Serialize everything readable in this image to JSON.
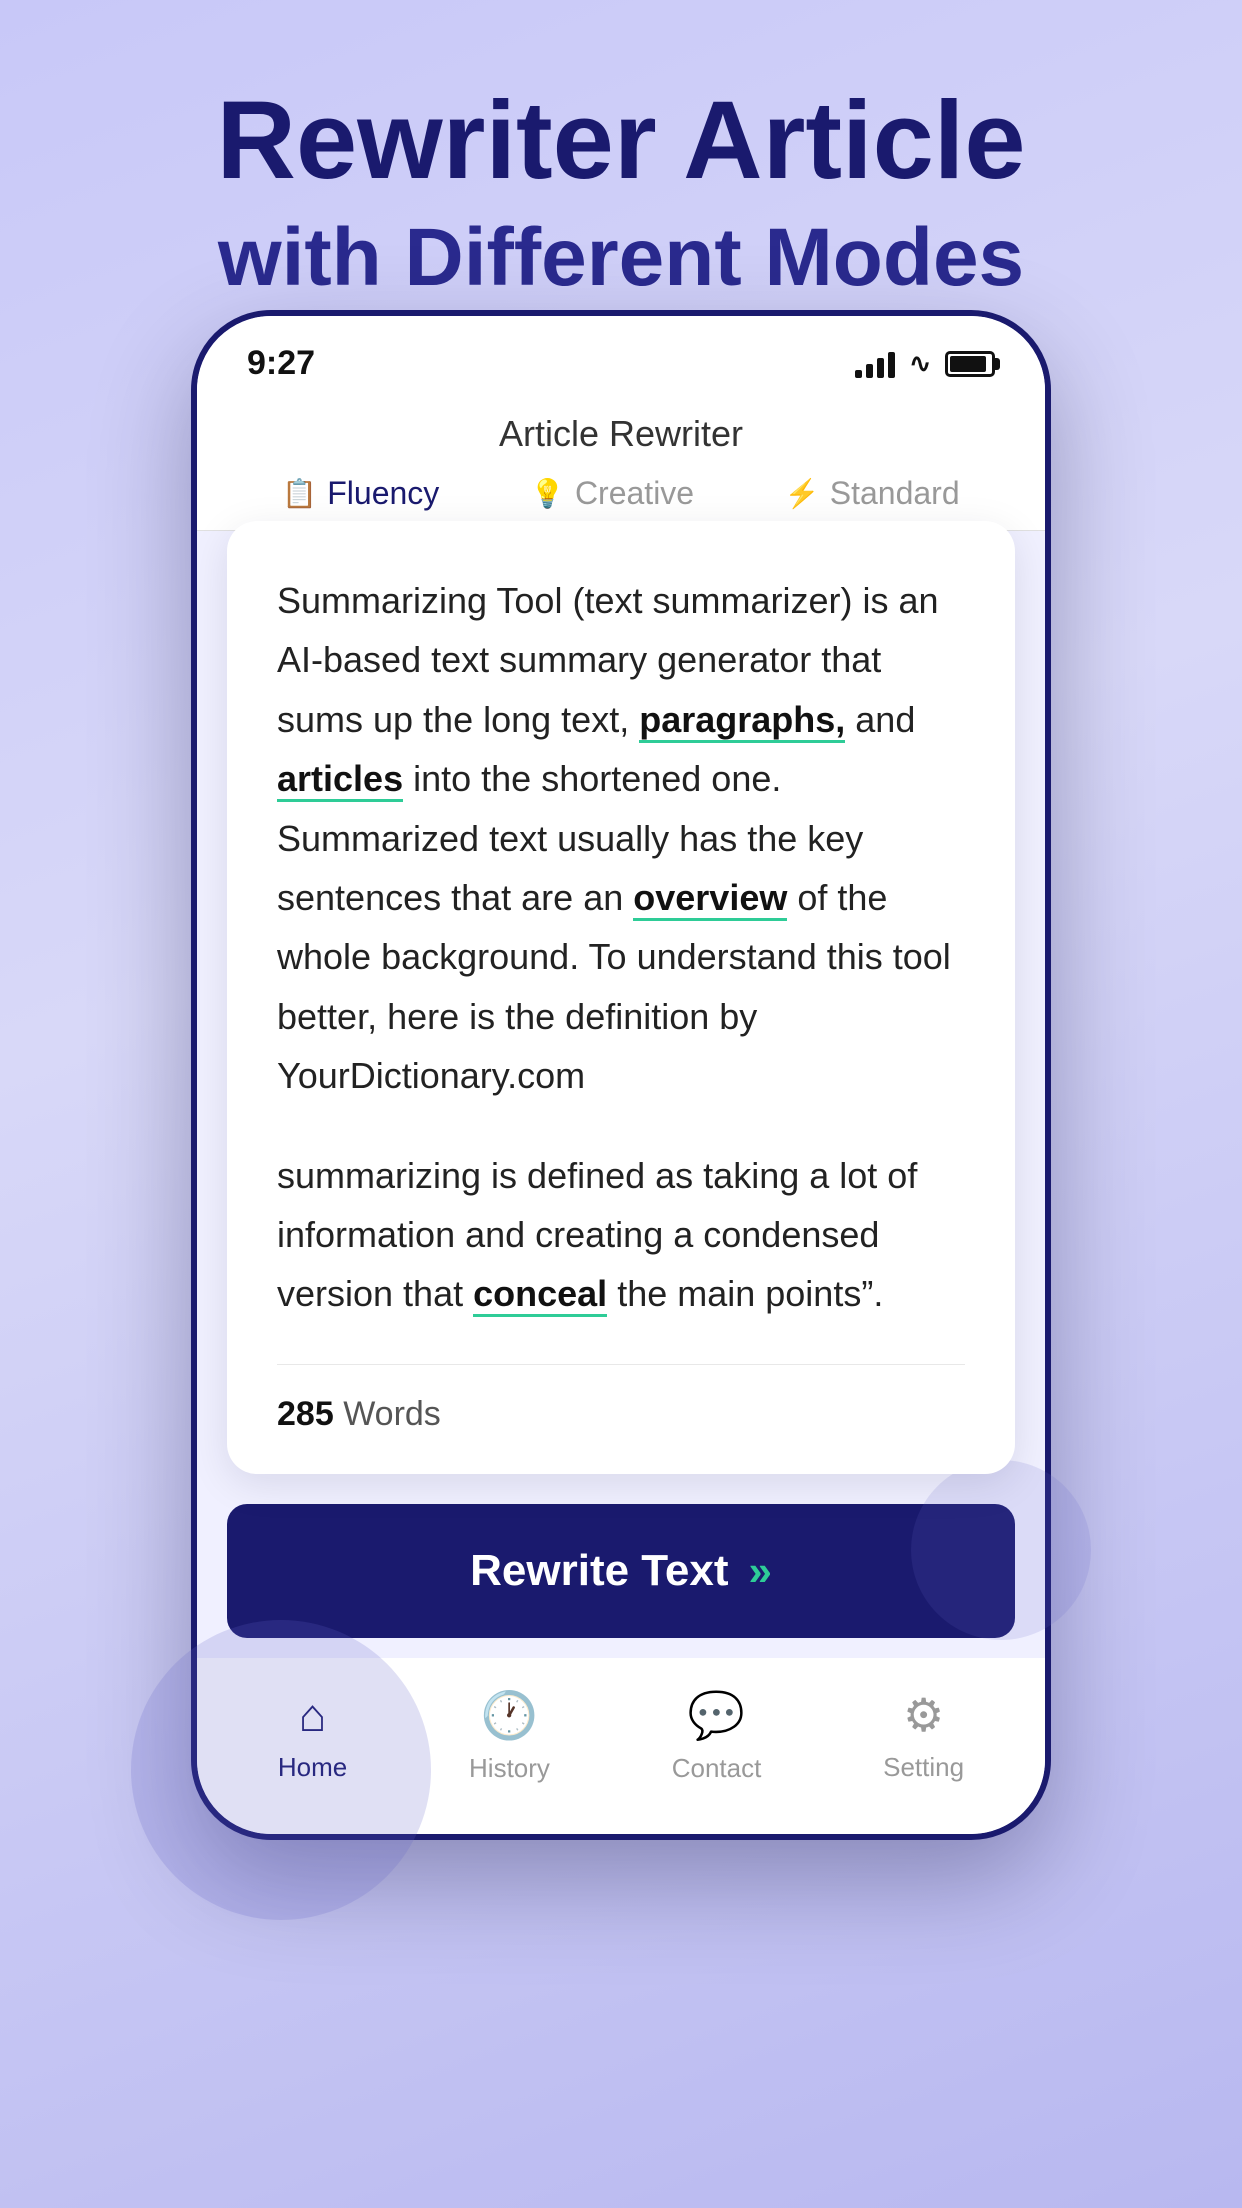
{
  "page": {
    "title_line1": "Rewriter Article",
    "title_line2": "with Different Modes"
  },
  "app": {
    "title": "Article Rewriter"
  },
  "status_bar": {
    "time": "9:27"
  },
  "tabs": [
    {
      "id": "fluency",
      "label": "Fluency",
      "active": true
    },
    {
      "id": "creative",
      "label": "Creative",
      "active": false
    },
    {
      "id": "standard",
      "label": "Standard",
      "active": false
    }
  ],
  "article": {
    "paragraph1": "Summarizing Tool (text summarizer) is an AI-based text summary generator that sums up the long text, paragraphs, and articles into the shortened one. Summarized text usually has the key sentences that are an overview of the whole background. To understand this tool better, here is the definition by YourDictionary.com",
    "paragraph2": "summarizing is defined as taking a lot of information and creating a condensed version that conceal the main points\".",
    "highlights": [
      "paragraphs",
      "articles",
      "overview",
      "conceal"
    ],
    "word_count_number": "285",
    "word_count_label": "Words"
  },
  "rewrite_button": {
    "label": "Rewrite Text",
    "arrows": "≫"
  },
  "bottom_nav": [
    {
      "id": "home",
      "label": "Home",
      "active": true,
      "icon": "⌂"
    },
    {
      "id": "history",
      "label": "History",
      "active": false,
      "icon": "🕐"
    },
    {
      "id": "contact",
      "label": "Contact",
      "active": false,
      "icon": "💬"
    },
    {
      "id": "setting",
      "label": "Setting",
      "active": false,
      "icon": "⚙"
    }
  ]
}
